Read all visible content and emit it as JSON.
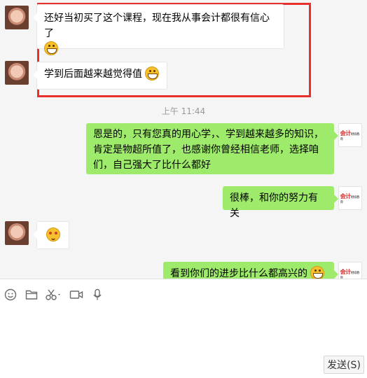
{
  "messages": [
    {
      "side": "left",
      "text": "还好当初买了这个课程，现在我从事会计都很有信心了",
      "emoji": "grin-icon"
    },
    {
      "side": "left",
      "text": "学到后面越来越觉得值",
      "emoji": "grin-icon"
    },
    {
      "side": "right",
      "text": "恩是的，只有您真的用心学，、学到越来越多的知识，肯定是物超所值了，也感谢你曾经相信老师，选择咱们，自己强大了比什么都好"
    },
    {
      "side": "right",
      "text": "很棒，和你的努力有关"
    },
    {
      "side": "left",
      "text": "",
      "emoji": "blush-icon"
    },
    {
      "side": "right",
      "text": "看到你们的进步比什么都高兴的",
      "emoji": "grin-icon"
    }
  ],
  "timestamp": "上午 11:44",
  "logo": {
    "big": "会计",
    "small": "继续教育"
  },
  "toolbar": [
    "emoji-icon",
    "folder-icon",
    "scissors-icon",
    "video-icon",
    "microphone-icon"
  ],
  "send_label": "发送(S)",
  "colors": {
    "highlight": "#e8312f",
    "bubble_right": "#9eea6a",
    "bubble_left": "#ffffff"
  }
}
